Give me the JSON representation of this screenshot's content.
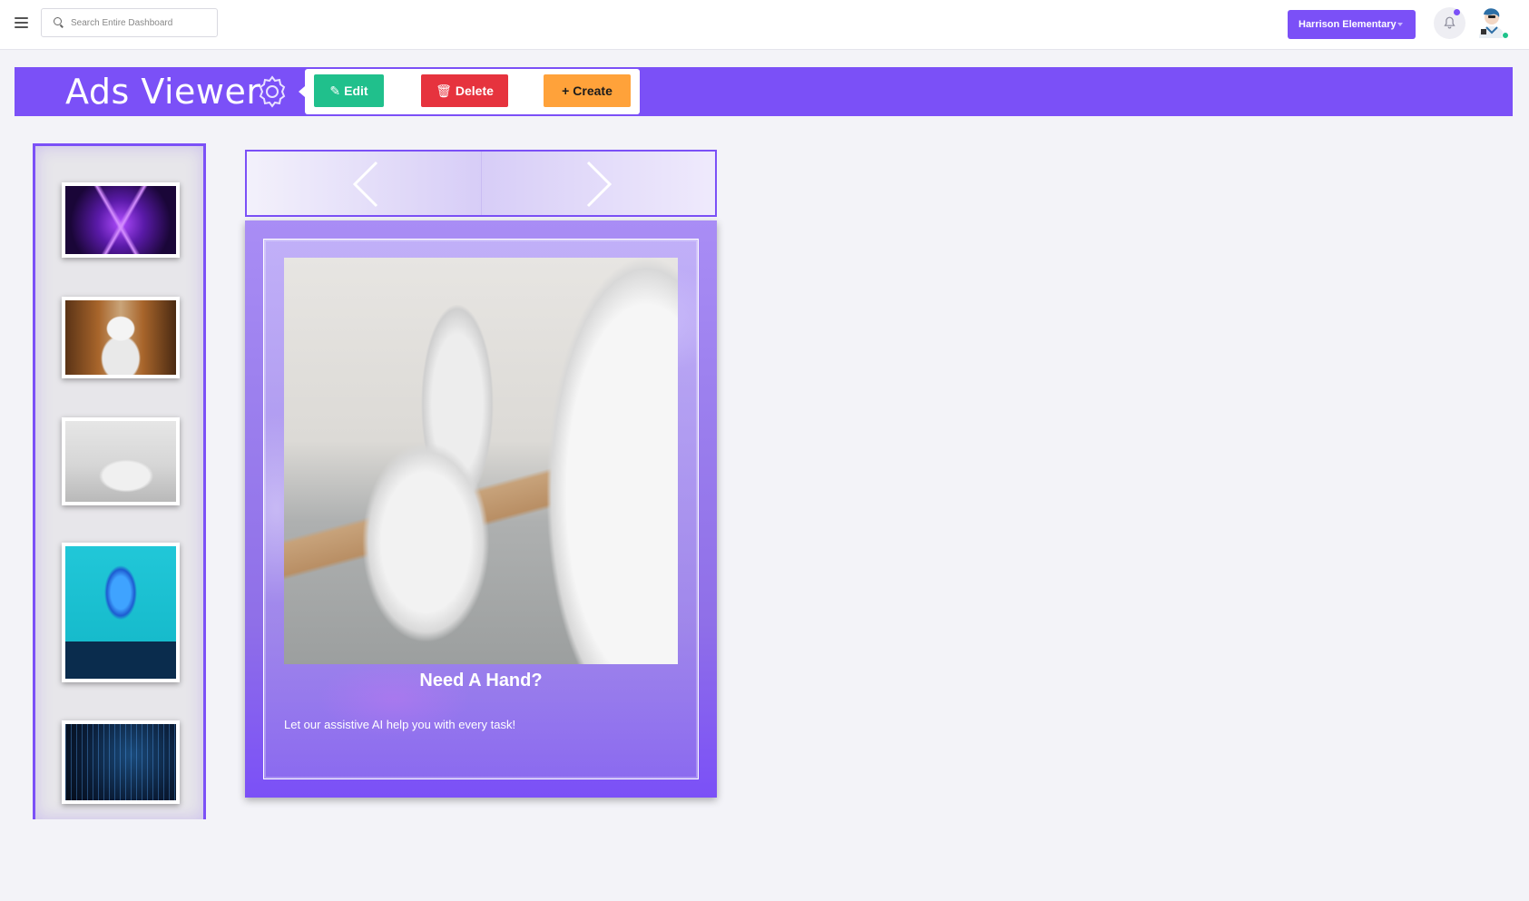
{
  "topbar": {
    "search": {
      "placeholder": "Search Entire Dashboard",
      "value": ""
    },
    "school_selector": {
      "label": "Harrison Elementary"
    },
    "notifications": {
      "has_unread": true
    },
    "colors": {
      "accent": "#7b50f7",
      "status_online": "#1ec28b"
    }
  },
  "header": {
    "title": "Ads Viewer",
    "actions": {
      "edit": {
        "icon": "pencil-icon",
        "label": "Edit",
        "color": "#20c08c"
      },
      "delete": {
        "icon": "trash-icon",
        "label": "Delete",
        "color": "#e6333e"
      },
      "create": {
        "icon": "plus-icon",
        "label": "Create",
        "color": "#ffa23a"
      }
    }
  },
  "thumbnails": [
    {
      "name": "neon-triangle-tunnel"
    },
    {
      "name": "pepper-robot"
    },
    {
      "name": "robot-hand"
    },
    {
      "name": "blue-glowing-hand"
    },
    {
      "name": "data-wall"
    }
  ],
  "carousel": {
    "selected_index": 2,
    "card": {
      "title": "Need A Hand?",
      "text": "Let our assistive AI help you with every task!"
    }
  }
}
